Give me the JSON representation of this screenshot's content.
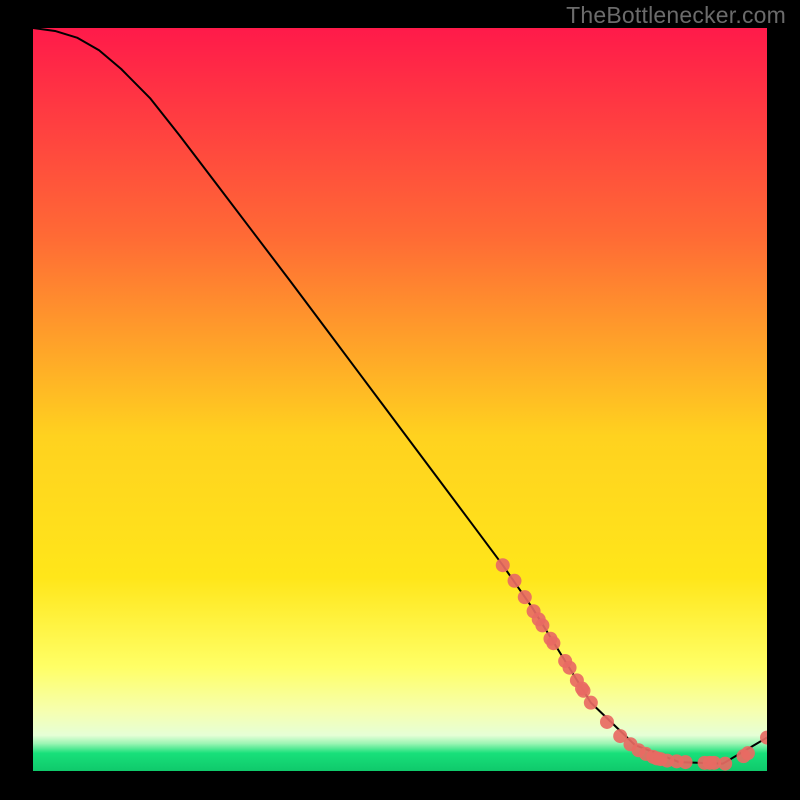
{
  "watermark": "TheBottlenecker.com",
  "colors": {
    "bg_black": "#000000",
    "grad_top": "#ff1a4a",
    "grad_mid1": "#ff7a2e",
    "grad_mid2": "#ffd21f",
    "grad_low1": "#ffff66",
    "grad_low2": "#f6ffb0",
    "grad_bottom_band": "#18e07a",
    "curve": "#000000",
    "marker_fill": "#e86a63",
    "marker_stroke": "#a93f3a"
  },
  "chart_data": {
    "type": "line",
    "title": "",
    "xlabel": "",
    "ylabel": "",
    "xlim": [
      0,
      100
    ],
    "ylim": [
      0,
      100
    ],
    "curve": {
      "x": [
        0,
        3,
        6,
        9,
        12,
        16,
        20,
        25,
        30,
        35,
        40,
        45,
        50,
        55,
        60,
        64,
        68,
        72,
        76,
        82,
        88,
        94,
        100
      ],
      "y": [
        100,
        99.6,
        98.7,
        97.0,
        94.5,
        90.5,
        85.5,
        79.0,
        72.5,
        66.0,
        59.4,
        52.8,
        46.2,
        39.6,
        33.0,
        27.7,
        22.0,
        15.6,
        9.2,
        3.5,
        1.2,
        1.0,
        4.5
      ]
    },
    "markers": {
      "x": [
        64.0,
        65.6,
        67.0,
        68.2,
        68.9,
        69.4,
        70.5,
        70.9,
        72.5,
        73.1,
        74.1,
        74.8,
        75.0,
        76.0,
        78.2,
        80.0,
        81.4,
        82.5,
        83.5,
        84.5,
        85.0,
        85.5,
        86.4,
        87.7,
        88.9,
        91.5,
        92.2,
        92.8,
        94.3,
        96.8,
        97.4,
        100.0
      ],
      "y": [
        27.7,
        25.6,
        23.4,
        21.5,
        20.4,
        19.6,
        17.8,
        17.2,
        14.8,
        13.9,
        12.2,
        11.1,
        10.8,
        9.2,
        6.6,
        4.7,
        3.6,
        2.8,
        2.3,
        1.9,
        1.7,
        1.6,
        1.4,
        1.3,
        1.2,
        1.1,
        1.1,
        1.1,
        1.0,
        2.0,
        2.4,
        4.5
      ]
    }
  }
}
